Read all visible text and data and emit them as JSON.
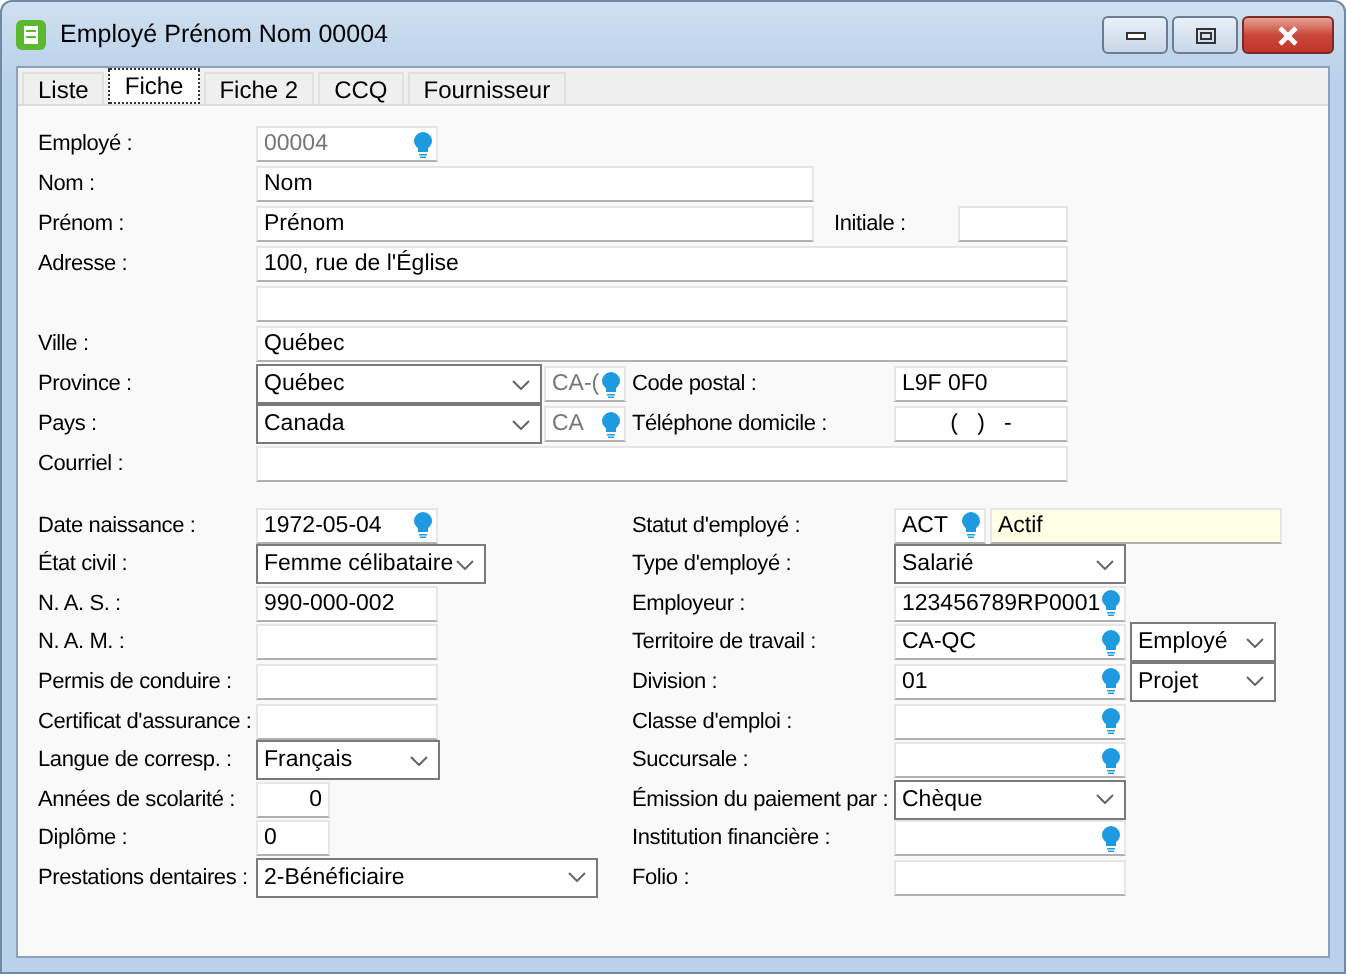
{
  "window": {
    "title": "Employé Prénom Nom 00004"
  },
  "tabs": [
    {
      "label": "Liste",
      "selected": false
    },
    {
      "label": "Fiche",
      "selected": true
    },
    {
      "label": "Fiche 2",
      "selected": false
    },
    {
      "label": "CCQ",
      "selected": false
    },
    {
      "label": "Fournisseur",
      "selected": false
    }
  ],
  "top_rows": [
    {
      "items": [
        {
          "kind": "label",
          "text": "Employé :"
        },
        {
          "kind": "code",
          "value": "00004"
        }
      ]
    },
    {
      "items": [
        {
          "kind": "label",
          "text": "Nom :"
        },
        {
          "kind": "text",
          "value": "Nom"
        }
      ]
    },
    {
      "items": [
        {
          "kind": "label",
          "text": "Prénom :"
        },
        {
          "kind": "text",
          "value": "Prénom"
        },
        {
          "kind": "label",
          "text": "Initiale :"
        },
        {
          "kind": "text"
        }
      ]
    },
    {
      "items": [
        {
          "kind": "label",
          "text": "Adresse :"
        },
        {
          "kind": "text",
          "value": "100, rue de l'Église"
        }
      ]
    },
    {
      "items": [
        {
          "kind": "text"
        }
      ]
    },
    {
      "items": [
        {
          "kind": "label",
          "text": "Ville :"
        },
        {
          "kind": "text",
          "value": "Québec"
        }
      ]
    },
    {
      "items": [
        {
          "kind": "label",
          "text": "Province :"
        },
        {
          "kind": "select",
          "value": "Québec"
        },
        {
          "kind": "code",
          "value": "CA-("
        },
        {
          "kind": "label",
          "text": "Code postal :"
        },
        {
          "kind": "text",
          "value": "L9F 0F0"
        }
      ]
    },
    {
      "items": [
        {
          "kind": "label",
          "text": "Pays :"
        },
        {
          "kind": "select",
          "value": "Canada"
        },
        {
          "kind": "code",
          "value": "CA"
        },
        {
          "kind": "label",
          "text": "Téléphone domicile :"
        },
        {
          "kind": "phone",
          "value": "(   )   -"
        }
      ]
    },
    {
      "items": [
        {
          "kind": "label",
          "text": "Courriel :"
        },
        {
          "kind": "text"
        }
      ]
    }
  ],
  "bottom_rows": [
    {
      "left": [
        {
          "kind": "label",
          "text": "Date naissance :"
        },
        {
          "kind": "lookup",
          "value": "1972-05-04"
        }
      ],
      "right": [
        {
          "kind": "label",
          "text": "Statut d'employé :"
        },
        {
          "kind": "lookup",
          "value": "ACT"
        },
        {
          "kind": "description",
          "value": "Actif"
        }
      ]
    },
    {
      "left": [
        {
          "kind": "label",
          "text": "État civil :"
        },
        {
          "kind": "select",
          "value": "Femme célibataire"
        }
      ],
      "right": [
        {
          "kind": "label",
          "text": "Type d'employé :"
        },
        {
          "kind": "select",
          "value": "Salarié"
        }
      ]
    },
    {
      "left": [
        {
          "kind": "label",
          "text": "N. A. S. :"
        },
        {
          "kind": "text",
          "value": "990-000-002"
        }
      ],
      "right": [
        {
          "kind": "label",
          "text": "Employeur :"
        },
        {
          "kind": "lookup",
          "value": "123456789RP0001"
        }
      ]
    },
    {
      "left": [
        {
          "kind": "label",
          "text": "N. A. M. :"
        },
        {
          "kind": "text"
        }
      ],
      "right": [
        {
          "kind": "label",
          "text": "Territoire de travail :"
        },
        {
          "kind": "lookup",
          "value": "CA-QC"
        },
        {
          "kind": "select",
          "value": "Employé"
        }
      ]
    },
    {
      "left": [
        {
          "kind": "label",
          "text": "Permis de conduire :"
        },
        {
          "kind": "text"
        }
      ],
      "right": [
        {
          "kind": "label",
          "text": "Division :"
        },
        {
          "kind": "lookup",
          "value": "01"
        },
        {
          "kind": "select",
          "value": "Projet"
        }
      ]
    },
    {
      "left": [
        {
          "kind": "label",
          "text": "Certificat d'assurance :"
        },
        {
          "kind": "text"
        }
      ],
      "right": [
        {
          "kind": "label",
          "text": "Classe d'emploi :"
        },
        {
          "kind": "lookup"
        }
      ]
    },
    {
      "left": [
        {
          "kind": "label",
          "text": "Langue de corresp. :"
        },
        {
          "kind": "select",
          "value": "Français"
        }
      ],
      "right": [
        {
          "kind": "label",
          "text": "Succursale :"
        },
        {
          "kind": "lookup"
        }
      ]
    },
    {
      "left": [
        {
          "kind": "label",
          "text": "Années de scolarité :"
        },
        {
          "kind": "number",
          "value": "0"
        }
      ],
      "right": [
        {
          "kind": "label",
          "text": "Émission du paiement par :"
        },
        {
          "kind": "select",
          "value": "Chèque"
        }
      ]
    },
    {
      "left": [
        {
          "kind": "label",
          "text": "Diplôme :"
        },
        {
          "kind": "text",
          "value": "0"
        }
      ],
      "right": [
        {
          "kind": "label",
          "text": "Institution financière :"
        },
        {
          "kind": "lookup"
        }
      ]
    },
    {
      "left": [
        {
          "kind": "label",
          "text": "Prestations dentaires :"
        },
        {
          "kind": "select",
          "value": "2-Bénéficiaire"
        }
      ],
      "right": [
        {
          "kind": "label",
          "text": "Folio :"
        },
        {
          "kind": "text"
        }
      ]
    }
  ]
}
